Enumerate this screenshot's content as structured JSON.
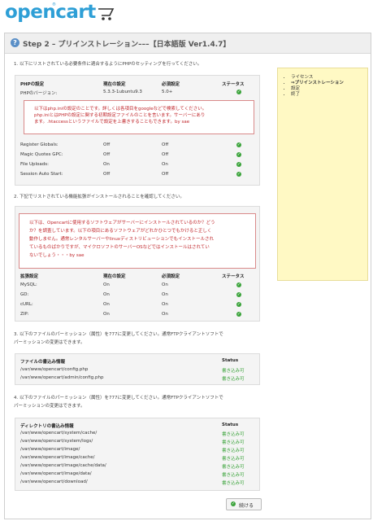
{
  "logo": {
    "text": "opencart",
    "reg": "®"
  },
  "header": {
    "title": "Step 2 – プリインストレーション–––【日本語版 Ver1.4.7】"
  },
  "sidebar": {
    "items": [
      "ライセンス",
      "⇒プリインストレーション",
      "設定",
      "終了"
    ]
  },
  "sec1": {
    "text": "1. 以下にリストされている必要条件に適合するようにPHPのセッティングを行ってください。",
    "headers": [
      "PHPの設定",
      "現在の設定",
      "必須設定",
      "ステータス"
    ],
    "version_row": [
      "PHPのバージョン:",
      "5.3.3-1ubuntu9.3",
      "5.0+"
    ],
    "err_lines": [
      "以下はphp.iniの設定のことです。詳しくは各項目をgoogleなどで検索してください。",
      "php.iniとはPHPの設定に関する初期設定ファイルのことを言います。サーバーにあり",
      "ます。.htaccessというファイルで設定を上書きすることもできます。by sae"
    ],
    "rows": [
      [
        "Register Globals:",
        "Off",
        "Off"
      ],
      [
        "Magic Quotes GPC:",
        "Off",
        "Off"
      ],
      [
        "File Uploads:",
        "On",
        "On"
      ],
      [
        "Session Auto Start:",
        "Off",
        "Off"
      ]
    ]
  },
  "sec2": {
    "text": "2. 下記でリストされている機能拡張がインストールされることを確認してください。",
    "err_lines": [
      "以下は、Opencartに使用するソフトウェアがサーバーにインストールされているのか？どう",
      "か？を調査しています。以下の項目にあるソフトウェアがどれかひとつでもかけると正しく",
      "動作しません。通常レンタルサーバーやlinuxディストリビューションでもインストールされ",
      "ているものばかりですが、マイクロソフトのサーバーOSなどではインストールはされてい",
      "ないでしょう・・・by sae"
    ],
    "headers": [
      "拡張設定",
      "現在の設定",
      "必須設定",
      "ステータス"
    ],
    "rows": [
      [
        "MySQL:",
        "On",
        "On"
      ],
      [
        "GD:",
        "On",
        "On"
      ],
      [
        "cURL:",
        "On",
        "On"
      ],
      [
        "ZIP:",
        "On",
        "On"
      ]
    ]
  },
  "sec3": {
    "text1": "3. 以下のファイルのパーミッション（属性）を777に変更してください。通常FTPクライアントソフトで",
    "text2": "パーミッションの変更はできます。",
    "headers": [
      "ファイルの書込み情報",
      "Status"
    ],
    "rows": [
      [
        "/var/www/opencart/config.php",
        "書き込み可"
      ],
      [
        "/var/www/opencart/admin/config.php",
        "書き込み可"
      ]
    ]
  },
  "sec4": {
    "text1": "4. 以下のファイルのパーミッション（属性）を777に変更してください。通常FTPクライアントソフトで",
    "text2": "パーミッションの変更はできます。",
    "headers": [
      "ディレクトリの書込み情報",
      "Status"
    ],
    "rows": [
      [
        "/var/www/opencart/system/cache/",
        "書き込み可"
      ],
      [
        "/var/www/opencart/system/logs/",
        "書き込み可"
      ],
      [
        "/var/www/opencart/image/",
        "書き込み可"
      ],
      [
        "/var/www/opencart/image/cache/",
        "書き込み可"
      ],
      [
        "/var/www/opencart/image/cache/data/",
        "書き込み可"
      ],
      [
        "/var/www/opencart/image/data/",
        "書き込み可"
      ],
      [
        "/var/www/opencart/download/",
        "書き込み可"
      ]
    ]
  },
  "button": {
    "label": "続ける"
  },
  "colors": {
    "brand": "#2e9fd6",
    "ok": "#3aa33a",
    "error": "#c0262b",
    "sidebar_bg": "#fff9c4"
  }
}
